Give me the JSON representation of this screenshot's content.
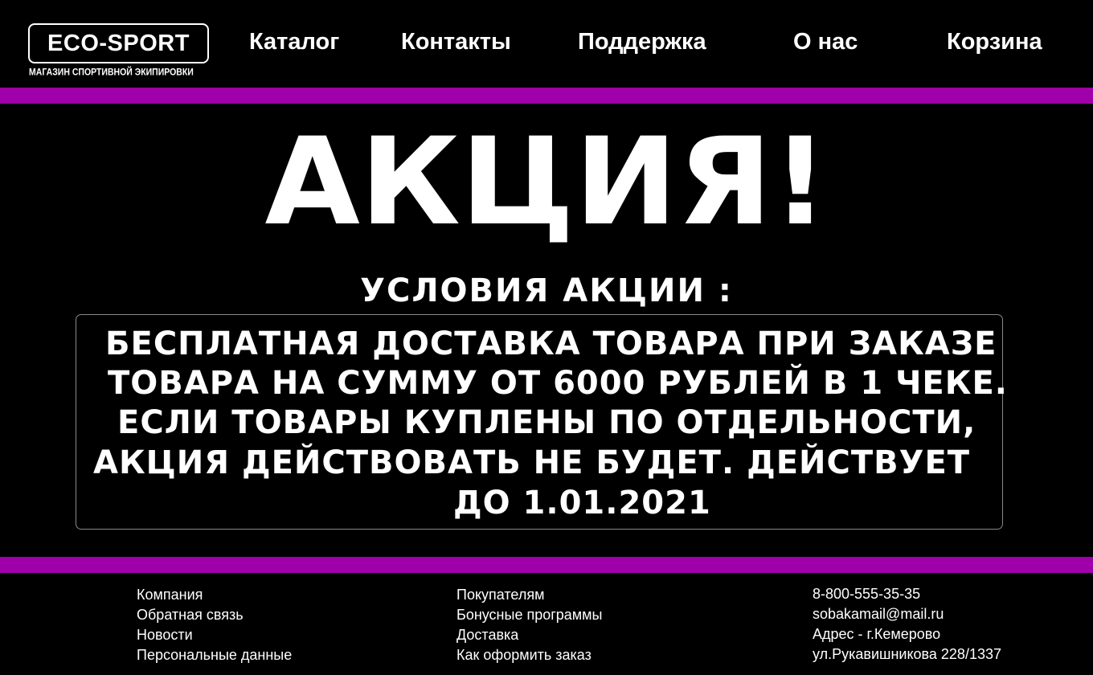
{
  "header": {
    "logo": {
      "title": "ECO-SPORT",
      "subtitle": "МАГАЗИН СПОРТИВНОЙ ЭКИПИРОВКИ"
    },
    "nav": [
      "Каталог",
      "Контакты",
      "Поддержка",
      "О нас",
      "Корзина"
    ]
  },
  "promo": {
    "title": "АКЦИЯ!",
    "subtitle": "УСЛОВИЯ АКЦИИ :",
    "lines": [
      "БЕСПЛАТНАЯ ДОСТАВКА ТОВАРА ПРИ ЗАКАЗЕ",
      "ТОВАРА НА СУММУ ОТ 6000 РУБЛЕЙ В 1 ЧЕКЕ.",
      "ЕСЛИ ТОВАРЫ КУПЛЕНЫ ПО ОТДЕЛЬНОСТИ,",
      "АКЦИЯ ДЕЙСТВОВАТЬ НЕ БУДЕТ. ДЕЙСТВУЕТ",
      "ДО 1.01.2021"
    ]
  },
  "footer": {
    "company": [
      "Компания",
      "Обратная связь",
      "Новости",
      "Персональные данные"
    ],
    "customers": [
      "Покупателям",
      "Бонусные программы",
      "Доставка",
      "Как оформить заказ"
    ],
    "contacts": [
      "8-800-555-35-35",
      "sobakamail@mail.ru",
      "Адрес - г.Кемерово",
      "ул.Рукавишникова 228/1337"
    ]
  },
  "colors": {
    "background": "#000000",
    "accent_stripe": "#a000aa",
    "text": "#ffffff"
  }
}
